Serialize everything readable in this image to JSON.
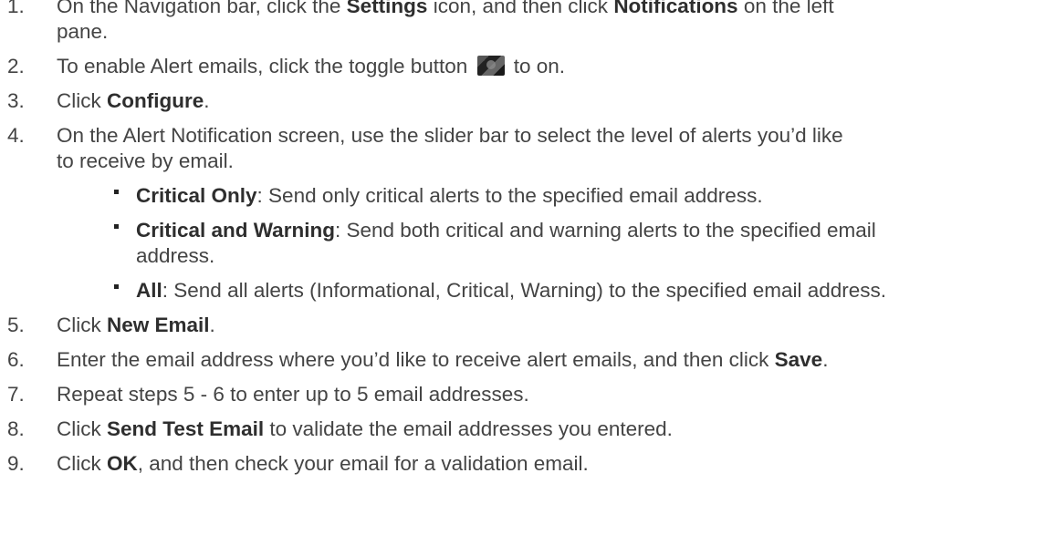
{
  "steps": [
    {
      "num": "1.",
      "parts": [
        "On the Navigation bar, click the ",
        "Settings",
        " icon, and then click ",
        "Notifications",
        " on the left"
      ],
      "cont": "pane."
    },
    {
      "num": "2.",
      "pre": "To enable Alert emails, click the toggle button ",
      "post": " to on.",
      "icon": "toggle-switch-icon"
    },
    {
      "num": "3.",
      "pre": "Click ",
      "bold": "Configure",
      "post": "."
    },
    {
      "num": "4.",
      "text": "On the Alert Notification screen, use the slider bar to select the level of alerts you’d like",
      "cont": "to receive by email.",
      "bullets": [
        {
          "bold": "Critical Only",
          "text": ": Send only critical alerts to the specified email address."
        },
        {
          "bold": "Critical and Warning",
          "text": ": Send both critical and warning alerts to the specified email",
          "cont": "address."
        },
        {
          "bold": "All",
          "text": ": Send all alerts (Informational, Critical, Warning) to the specified email address."
        }
      ]
    },
    {
      "num": "5.",
      "pre": "Click ",
      "bold": "New Email",
      "post": "."
    },
    {
      "num": "6.",
      "pre": "Enter the email address where you’d like to receive alert emails, and then click ",
      "bold": "Save",
      "post": "."
    },
    {
      "num": "7.",
      "text": "Repeat steps 5 - 6 to enter up to 5 email addresses."
    },
    {
      "num": "8.",
      "pre": "Click ",
      "bold": "Send Test Email",
      "post": " to validate the email addresses you entered."
    },
    {
      "num": "9.",
      "pre": "Click ",
      "bold": "OK",
      "post": ", and then check your email for a validation email."
    }
  ]
}
